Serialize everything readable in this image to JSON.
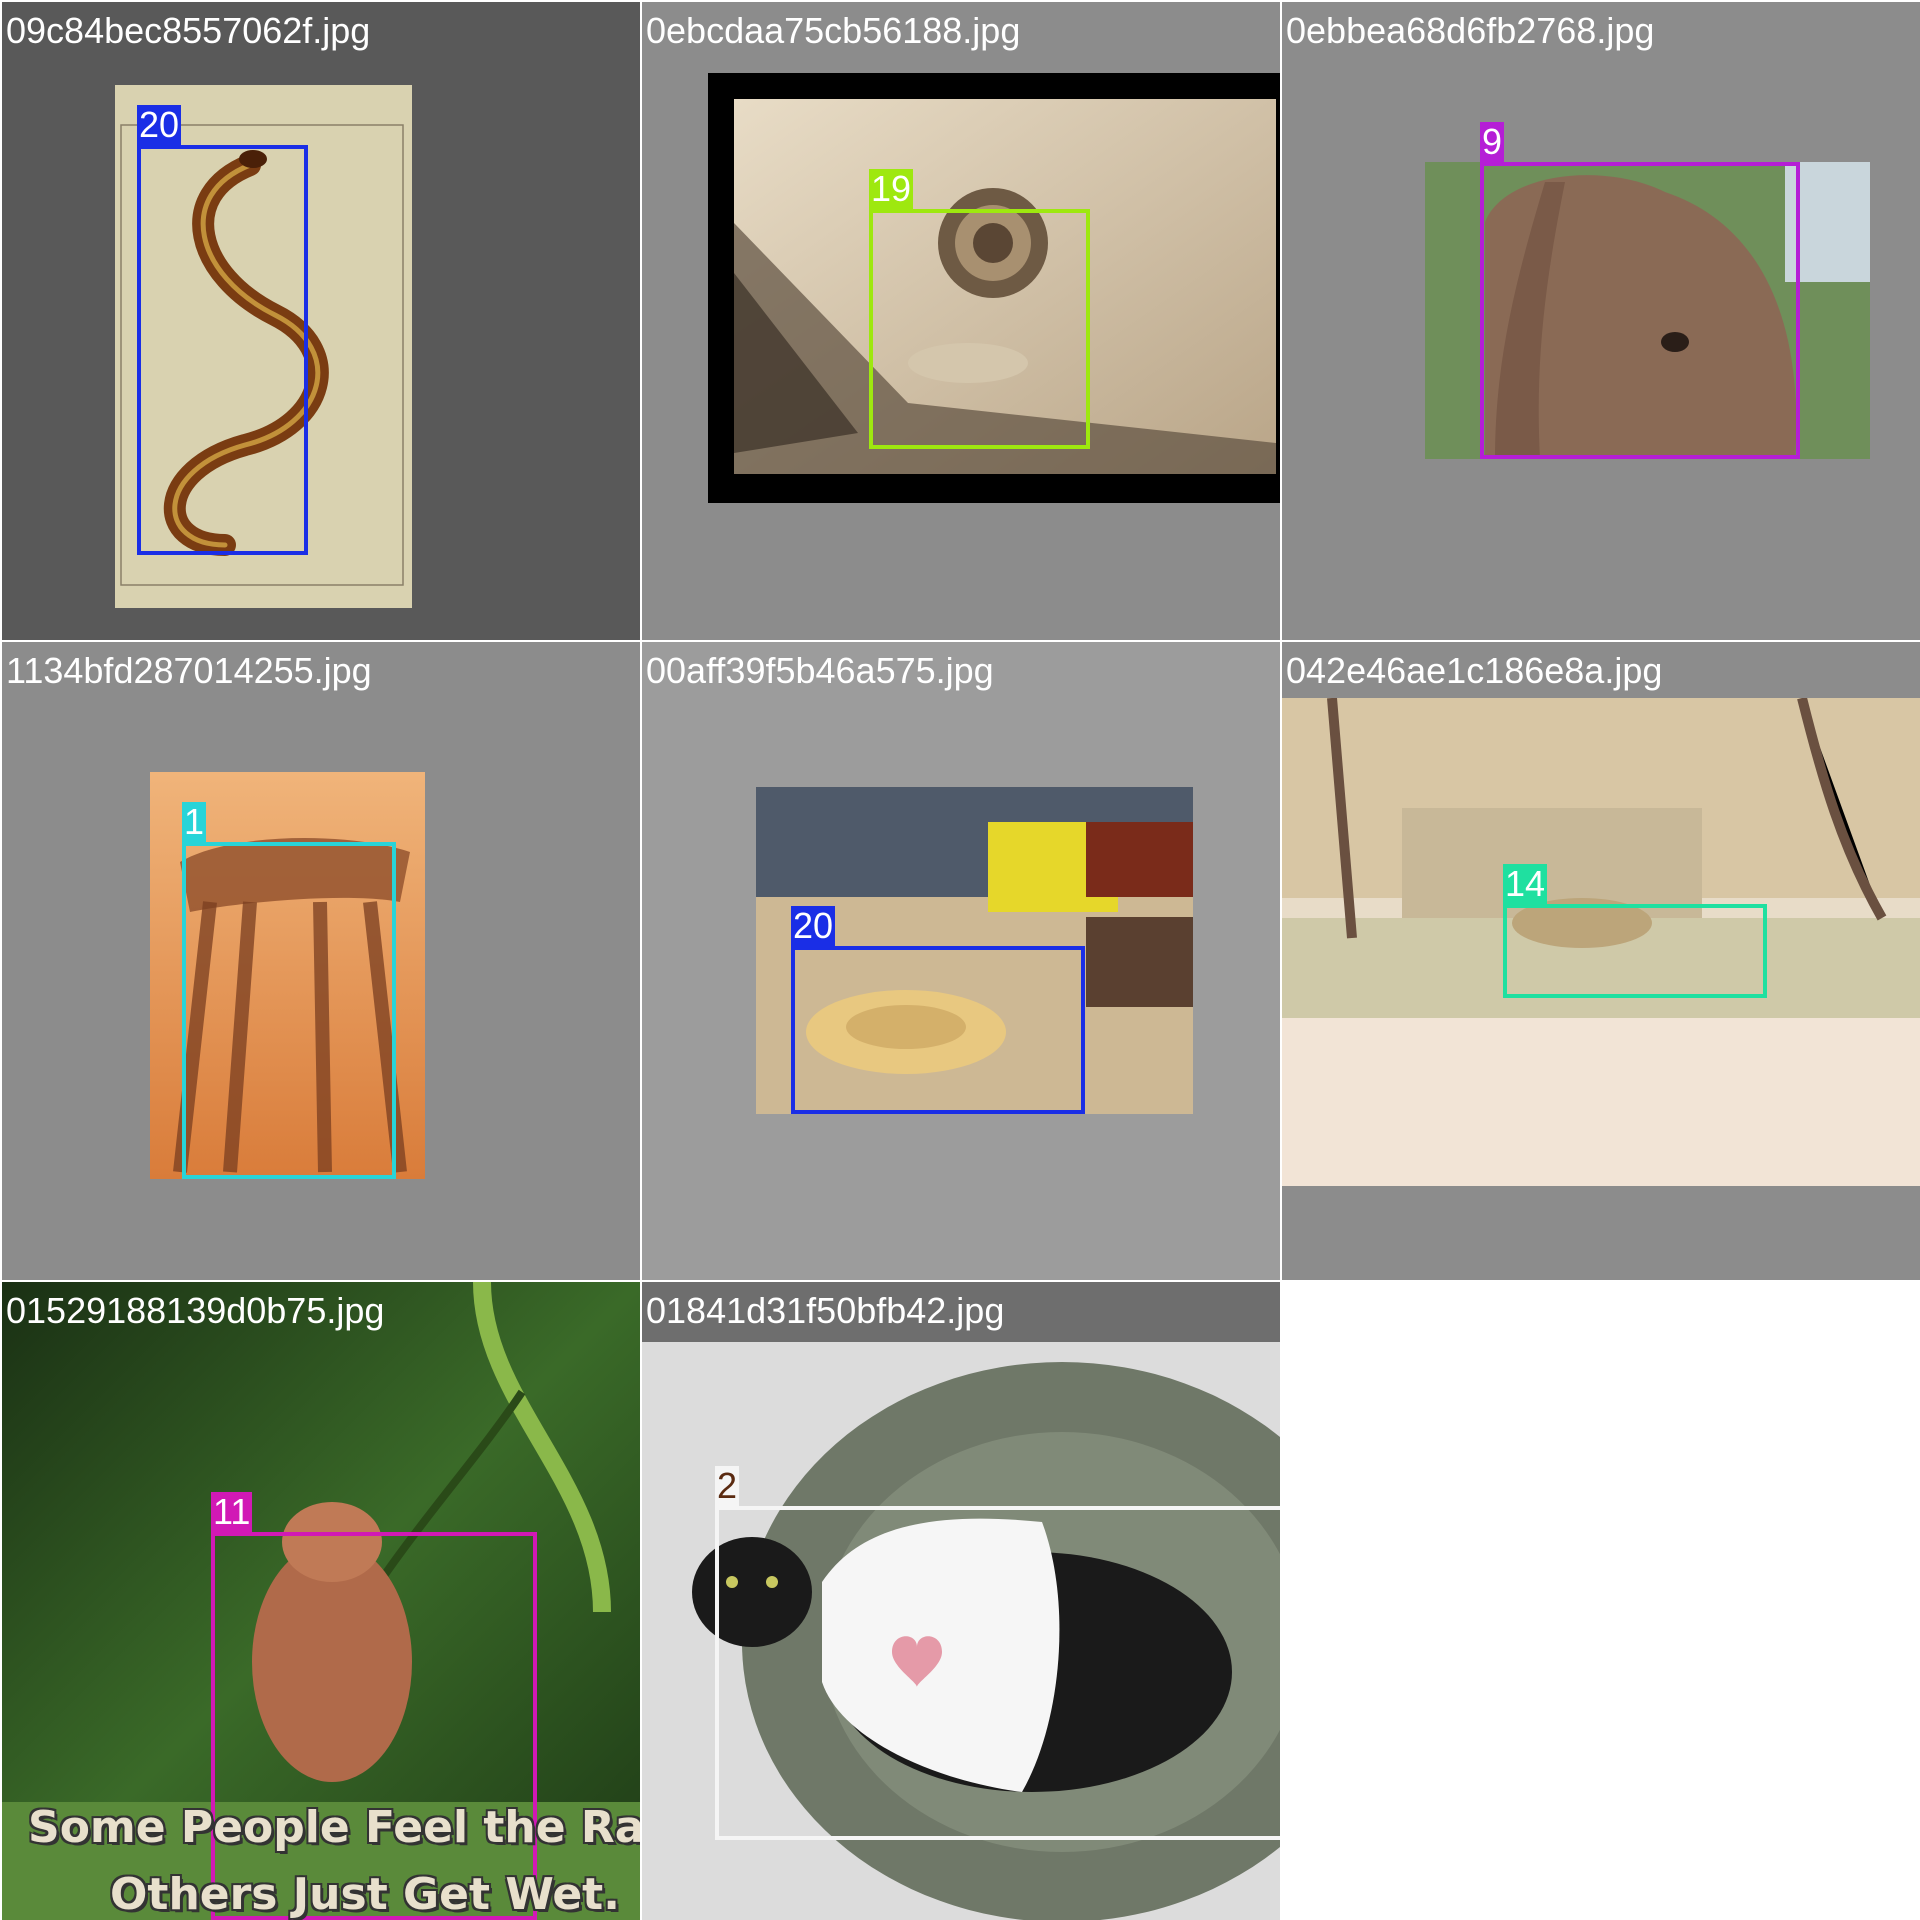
{
  "tiles": [
    {
      "filename": "09c84bec8557062f.jpg",
      "labels": [
        "20"
      ]
    },
    {
      "filename": "0ebcdaa75cb56188.jpg",
      "labels": [
        "19"
      ]
    },
    {
      "filename": "0ebbea68d6fb2768.jpg",
      "labels": [
        "9"
      ]
    },
    {
      "filename": "1134bfd287014255.jpg",
      "labels": [
        "1"
      ]
    },
    {
      "filename": "00aff39f5b46a575.jpg",
      "labels": [
        "20"
      ]
    },
    {
      "filename": "042e46ae1c186e8a.jpg",
      "labels": [
        "14"
      ]
    },
    {
      "filename": "01529188139d0b75.jpg",
      "labels": [
        "11"
      ],
      "caption_line1": "Some People Feel the Ra",
      "caption_line2": "Others Just Get Wet."
    },
    {
      "filename": "01841d31f50bfb42.jpg",
      "labels": [
        "2"
      ]
    }
  ],
  "colors": {
    "class_20": "#1a2ee6",
    "class_19": "#9ee80f",
    "class_9": "#b51ed6",
    "class_1": "#28d4d8",
    "class_14": "#1fe0a0",
    "class_11": "#d119b5",
    "class_2": "#f5f5f5"
  }
}
